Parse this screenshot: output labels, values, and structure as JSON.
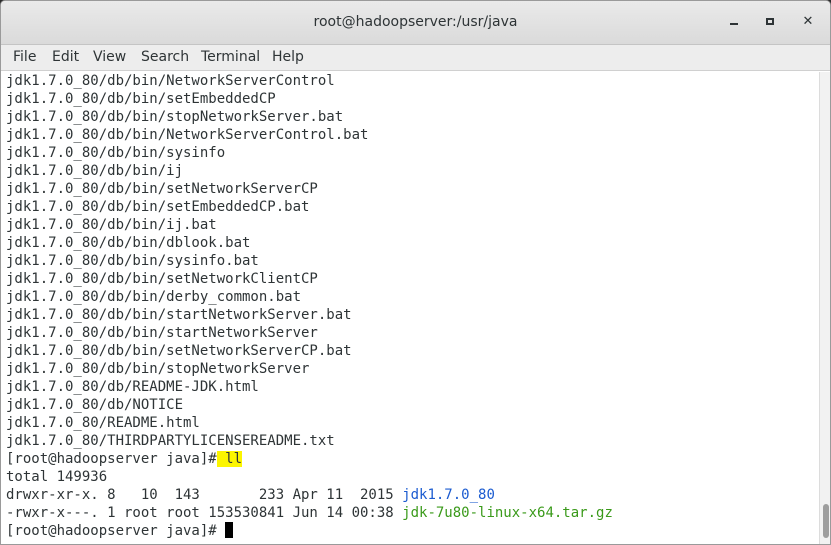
{
  "window": {
    "title": "root@hadoopserver:/usr/java",
    "minimize_icon": "minimize-icon",
    "maximize_icon": "maximize-icon",
    "close_icon": "close-icon",
    "close_glyph": "✕"
  },
  "menu": [
    "File",
    "Edit",
    "View",
    "Search",
    "Terminal",
    "Help"
  ],
  "terminal": {
    "output_lines": [
      "jdk1.7.0_80/db/bin/NetworkServerControl",
      "jdk1.7.0_80/db/bin/setEmbeddedCP",
      "jdk1.7.0_80/db/bin/stopNetworkServer.bat",
      "jdk1.7.0_80/db/bin/NetworkServerControl.bat",
      "jdk1.7.0_80/db/bin/sysinfo",
      "jdk1.7.0_80/db/bin/ij",
      "jdk1.7.0_80/db/bin/setNetworkServerCP",
      "jdk1.7.0_80/db/bin/setEmbeddedCP.bat",
      "jdk1.7.0_80/db/bin/ij.bat",
      "jdk1.7.0_80/db/bin/dblook.bat",
      "jdk1.7.0_80/db/bin/sysinfo.bat",
      "jdk1.7.0_80/db/bin/setNetworkClientCP",
      "jdk1.7.0_80/db/bin/derby_common.bat",
      "jdk1.7.0_80/db/bin/startNetworkServer.bat",
      "jdk1.7.0_80/db/bin/startNetworkServer",
      "jdk1.7.0_80/db/bin/setNetworkServerCP.bat",
      "jdk1.7.0_80/db/bin/stopNetworkServer",
      "jdk1.7.0_80/db/README-JDK.html",
      "jdk1.7.0_80/db/NOTICE",
      "jdk1.7.0_80/README.html",
      "jdk1.7.0_80/THIRDPARTYLICENSEREADME.txt"
    ],
    "prompt": "[root@hadoopserver java]#",
    "command": " ll",
    "total": "total 149936",
    "listing": [
      {
        "perms": "drwxr-xr-x. 8   10  143       233 Apr 11  2015 ",
        "name": "jdk1.7.0_80",
        "color": "#1b5bd0"
      },
      {
        "perms": "-rwxr-x---. 1 root root 153530841 Jun 14 00:38 ",
        "name": "jdk-7u80-linux-x64.tar.gz",
        "color": "#3a9a1a"
      }
    ],
    "final_prompt": "[root@hadoopserver java]# ",
    "highlight_color": "#fcf500"
  }
}
